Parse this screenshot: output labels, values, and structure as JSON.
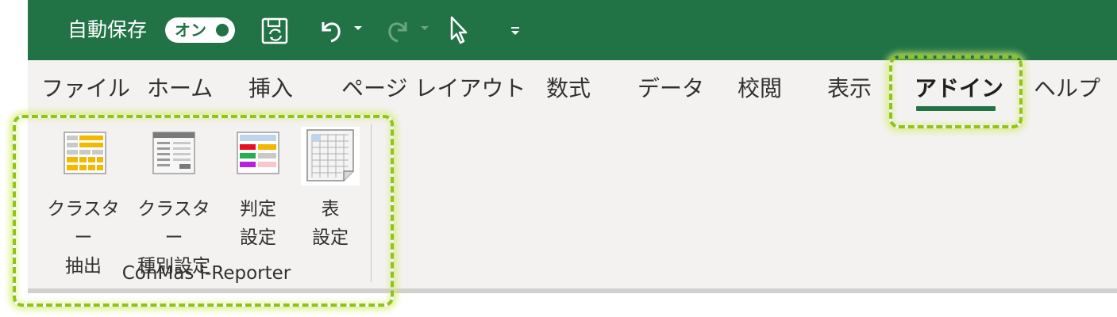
{
  "titlebar": {
    "autosave_label": "自動保存",
    "autosave_toggle": "オン",
    "icons": [
      "save-sync-icon",
      "undo-icon",
      "redo-icon",
      "select-cursor-icon",
      "customize-qat-icon"
    ]
  },
  "tabs": [
    {
      "label": "ファイル"
    },
    {
      "label": "ホーム"
    },
    {
      "label": "挿入"
    },
    {
      "label": "ページ レイアウト"
    },
    {
      "label": "数式"
    },
    {
      "label": "データ"
    },
    {
      "label": "校閲"
    },
    {
      "label": "表示"
    },
    {
      "label": "アドイン",
      "active": true
    },
    {
      "label": "ヘルプ"
    }
  ],
  "group": {
    "label": "ConMas i-Reporter",
    "buttons": [
      {
        "label": "クラスター\n抽出",
        "icon": "cluster-extract-icon"
      },
      {
        "label": "クラスター\n種別設定",
        "icon": "cluster-type-icon"
      },
      {
        "label": "判定\n設定",
        "icon": "judgement-settings-icon"
      },
      {
        "label": "表\n設定",
        "icon": "table-settings-icon"
      }
    ]
  },
  "colors": {
    "excel_green": "#217346",
    "highlight": "#8fc31f",
    "ribbon_bg": "#f3f2f1"
  }
}
